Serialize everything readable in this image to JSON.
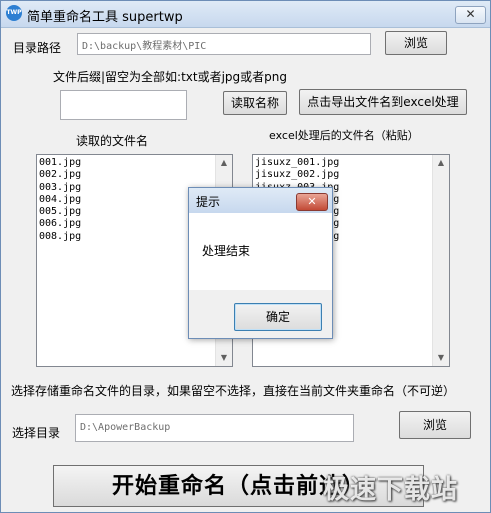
{
  "window": {
    "app_icon_text": "TWP",
    "title": "简单重命名工具 supertwp",
    "close_glyph": "✕"
  },
  "dir_path": {
    "label": "目录路径",
    "value": "D:\\backup\\教程素材\\PIC",
    "browse_label": "浏览"
  },
  "suffix": {
    "hint_label": "文件后缀|留空为全部如:txt或者jpg或者png",
    "value": "",
    "read_names_label": "读取名称",
    "export_label": "点击导出文件名到excel处理"
  },
  "lists": {
    "read_title": "读取的文件名",
    "read_items": [
      "001.jpg",
      "002.jpg",
      "003.jpg",
      "004.jpg",
      "005.jpg",
      "006.jpg",
      "008.jpg"
    ],
    "excel_title": "excel处理后的文件名（粘贴）",
    "excel_items": [
      "jisuxz_001.jpg",
      "jisuxz_002.jpg",
      "jisuxz_003.jpg",
      "jisuxz_004.jpg",
      "jisuxz_005.jpg",
      "jisuxz_006.jpg",
      "jisuxz_008.jpg"
    ]
  },
  "target_dir": {
    "hint": "选择存储重命名文件的目录，如果留空不选择，直接在当前文件夹重命名（不可逆）",
    "label": "选择目录",
    "value": "D:\\ApowerBackup",
    "browse_label": "浏览"
  },
  "start_button_label": "开始重命名（点击前选）",
  "dialog": {
    "title": "提示",
    "close_glyph": "✕",
    "message": "处理结束",
    "ok_label": "确定"
  },
  "watermark": "极速下载站"
}
